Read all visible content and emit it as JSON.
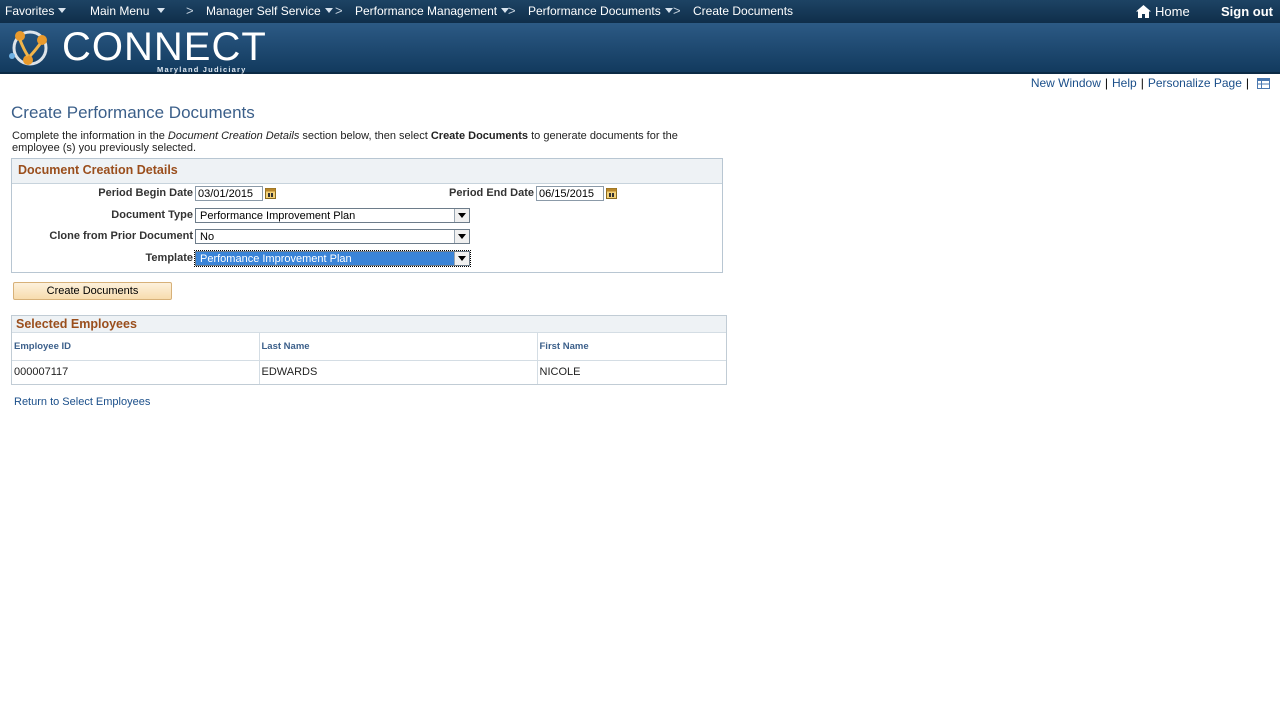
{
  "nav": {
    "favorites": "Favorites",
    "main_menu": "Main Menu",
    "manager_self_service": "Manager Self Service",
    "performance_management": "Performance Management",
    "performance_documents": "Performance Documents",
    "create_documents": "Create Documents",
    "home": "Home",
    "sign_out": "Sign out",
    "separator": ">"
  },
  "banner": {
    "logo_text": "CONNECT",
    "logo_sub": "Maryland Judiciary"
  },
  "page_links": {
    "new_window": "New Window",
    "help": "Help",
    "personalize": "Personalize Page",
    "bar": "|"
  },
  "page": {
    "title": "Create Performance Documents",
    "instr_1": "Complete the information in the ",
    "instr_2": "Document Creation Details",
    "instr_3": " section below, then select ",
    "instr_4": "Create Documents",
    "instr_5": " to generate documents for the employee (s) you previously selected."
  },
  "details": {
    "header": "Document Creation Details",
    "period_begin_label": "Period Begin Date",
    "period_begin_value": "03/01/2015",
    "period_end_label": "Period End Date",
    "period_end_value": "06/15/2015",
    "doc_type_label": "Document Type",
    "doc_type_value": "Performance Improvement Plan",
    "clone_label": "Clone from Prior Document",
    "clone_value": "No",
    "template_label": "Template",
    "template_value": "Perfomance Improvement Plan"
  },
  "create_button": "Create Documents",
  "employees": {
    "header": "Selected Employees",
    "columns": [
      "Employee ID",
      "Last Name",
      "First Name"
    ],
    "rows": [
      [
        "000007117",
        "EDWARDS",
        "NICOLE"
      ]
    ]
  },
  "return_link": "Return to Select Employees",
  "colors": {
    "nav_bg": "#0f2e4a",
    "section_header": "#9a4e1c",
    "link": "#1b4f8a",
    "button_bg": "#f7dcae"
  }
}
